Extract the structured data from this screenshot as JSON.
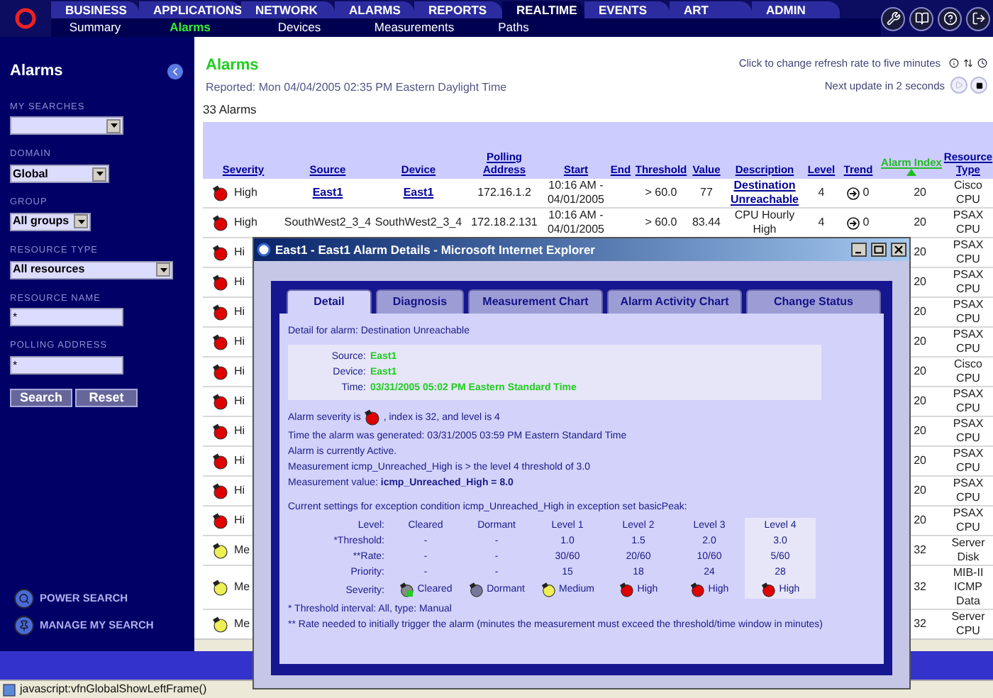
{
  "nav": {
    "tabs": [
      {
        "label": "BUSINESS",
        "selected": false
      },
      {
        "label": "APPLICATIONS",
        "selected": false
      },
      {
        "label": "NETWORK",
        "selected": false
      },
      {
        "label": "ALARMS",
        "selected": false
      },
      {
        "label": "REPORTS",
        "selected": false
      },
      {
        "label": "REALTIME",
        "selected": true
      },
      {
        "label": "EVENTS",
        "selected": false
      },
      {
        "label": "ART",
        "selected": false
      },
      {
        "label": "ADMIN",
        "selected": false
      }
    ],
    "subtabs": [
      {
        "label": "Summary",
        "selected": false
      },
      {
        "label": "Alarms",
        "selected": true
      },
      {
        "label": "Devices",
        "selected": false
      },
      {
        "label": "Measurements",
        "selected": false
      },
      {
        "label": "Paths",
        "selected": false
      }
    ]
  },
  "sidebar": {
    "title": "Alarms",
    "fields": [
      {
        "label": "MY SEARCHES",
        "kind": "select"
      },
      {
        "label": "DOMAIN",
        "kind": "select",
        "value": "Global"
      },
      {
        "label": "GROUP",
        "kind": "select",
        "value": "All groups"
      },
      {
        "label": "RESOURCE TYPE",
        "kind": "select",
        "value": "All resources"
      },
      {
        "label": "RESOURCE NAME",
        "kind": "input",
        "value": "*"
      },
      {
        "label": "POLLING ADDRESS",
        "kind": "input",
        "value": "*"
      }
    ],
    "buttons": [
      "Search",
      "Reset"
    ],
    "links": [
      "POWER SEARCH",
      "MANAGE MY SEARCH"
    ]
  },
  "main": {
    "title": "Alarms",
    "reported": "Reported: Mon 04/04/2005 02:35 PM Eastern Daylight Time",
    "refresh_link": "Click to change refresh rate to five minutes",
    "next_update": "Next update in 2 seconds",
    "count": "33 Alarms"
  },
  "table": {
    "columns": [
      {
        "label": "Severity",
        "sorted": false
      },
      {
        "label": "Source",
        "sorted": false
      },
      {
        "label": "Device",
        "sorted": false
      },
      {
        "label": "Polling Address",
        "sorted": false
      },
      {
        "label": "Start",
        "sorted": false
      },
      {
        "label": "End",
        "sorted": false
      },
      {
        "label": "Threshold",
        "sorted": false
      },
      {
        "label": "Value",
        "sorted": false
      },
      {
        "label": "Description",
        "sorted": false
      },
      {
        "label": "Level",
        "sorted": false
      },
      {
        "label": "Trend",
        "sorted": false
      },
      {
        "label": "Alarm Index",
        "sorted": true
      },
      {
        "label": "Resource Type",
        "sorted": false
      }
    ],
    "rows": [
      {
        "kind": "high",
        "linked": true,
        "severity_label": "High",
        "source": "East1",
        "device": "East1",
        "polling_address": "172.16.1.2",
        "start": "10:16 AM - 04/01/2005",
        "threshold": "> 60.0",
        "value": "77",
        "description": "Destination Unreachable",
        "level": "4",
        "trend": "0",
        "alarm_index": "20",
        "resource_type": "Cisco CPU"
      },
      {
        "kind": "high",
        "linked": false,
        "severity_label": "High",
        "source": "SouthWest2_3_4",
        "device": "SouthWest2_3_4",
        "polling_address": "172.18.2.131",
        "start": "10:16 AM - 04/01/2005",
        "threshold": "> 60.0",
        "value": "83.44",
        "description": "CPU Hourly High",
        "level": "4",
        "trend": "0",
        "alarm_index": "20",
        "resource_type": "PSAX CPU"
      },
      {
        "kind": "high",
        "severity_label": "Hi",
        "alarm_index": "20",
        "resource_type": "PSAX CPU"
      },
      {
        "kind": "high",
        "severity_label": "Hi",
        "alarm_index": "20",
        "resource_type": "PSAX CPU"
      },
      {
        "kind": "high",
        "severity_label": "Hi",
        "alarm_index": "20",
        "resource_type": "PSAX CPU"
      },
      {
        "kind": "high",
        "severity_label": "Hi",
        "alarm_index": "20",
        "resource_type": "PSAX CPU"
      },
      {
        "kind": "high",
        "severity_label": "Hi",
        "alarm_index": "20",
        "resource_type": "Cisco CPU"
      },
      {
        "kind": "high",
        "severity_label": "Hi",
        "alarm_index": "20",
        "resource_type": "PSAX CPU"
      },
      {
        "kind": "high",
        "severity_label": "Hi",
        "alarm_index": "20",
        "resource_type": "PSAX CPU"
      },
      {
        "kind": "high",
        "severity_label": "Hi",
        "alarm_index": "20",
        "resource_type": "PSAX CPU"
      },
      {
        "kind": "high",
        "severity_label": "Hi",
        "alarm_index": "20",
        "resource_type": "PSAX CPU"
      },
      {
        "kind": "high",
        "severity_label": "Hi",
        "alarm_index": "20",
        "resource_type": "PSAX CPU"
      },
      {
        "kind": "medium",
        "severity_label": "Me",
        "alarm_index": "32",
        "resource_type": "Server Disk"
      },
      {
        "kind": "medium",
        "severity_label": "Me",
        "alarm_index": "32",
        "resource_type": "MIB-II ICMP Data"
      },
      {
        "kind": "medium",
        "severity_label": "Me",
        "alarm_index": "32",
        "resource_type": "Server CPU"
      }
    ]
  },
  "dialog": {
    "title": "East1 - East1 Alarm Details - Microsoft Internet Explorer",
    "tabs": [
      {
        "label": "Detail",
        "selected": true
      },
      {
        "label": "Diagnosis",
        "selected": false
      },
      {
        "label": "Measurement Chart",
        "selected": false
      },
      {
        "label": "Alarm Activity Chart",
        "selected": false
      },
      {
        "label": "Change Status",
        "selected": false
      }
    ],
    "detail_for": "Detail for alarm: Destination Unreachable",
    "info": [
      {
        "label": "Source:",
        "value": "East1"
      },
      {
        "label": "Device:",
        "value": "East1"
      },
      {
        "label": "Time:",
        "value": "03/31/2005 05:02 PM Eastern Standard Time"
      }
    ],
    "severity_prefix": "Alarm severity is",
    "severity": {
      "kind": "high"
    },
    "severity_suffix": ", index is 32, and level is 4",
    "lines": [
      "Time the alarm was generated: 03/31/2005 03:59 PM Eastern Standard Time",
      "Alarm is currently Active.",
      "Measurement icmp_Unreached_High is > the level 4 threshold of 3.0",
      "Measurement value: **icmp_Unreached_High = 8.0**"
    ],
    "settings_intro": "Current settings for exception condition icmp_Unreached_High in exception set basicPeak:",
    "settings": {
      "level_label": "Level:",
      "levels": [
        {
          "label": "Cleared",
          "selected": false
        },
        {
          "label": "Dormant",
          "selected": false
        },
        {
          "label": "Level 1",
          "selected": false
        },
        {
          "label": "Level 2",
          "selected": false
        },
        {
          "label": "Level 3",
          "selected": false
        },
        {
          "label": "Level 4",
          "selected": true
        }
      ],
      "rows": [
        {
          "label": "*Threshold:",
          "values": [
            "-",
            "-",
            "1.0",
            "1.5",
            "2.0",
            "3.0"
          ]
        },
        {
          "label": "**Rate:",
          "values": [
            "-",
            "-",
            "30/60",
            "20/60",
            "10/60",
            "5/60"
          ]
        },
        {
          "label": "Priority:",
          "values": [
            "-",
            "-",
            "15",
            "18",
            "24",
            "28"
          ]
        }
      ],
      "severity_label": "Severity:",
      "severities": [
        {
          "kind": "cleared",
          "label": "Cleared"
        },
        {
          "kind": "dormant",
          "label": "Dormant"
        },
        {
          "kind": "medium",
          "label": "Medium"
        },
        {
          "kind": "high",
          "label": "High"
        },
        {
          "kind": "high",
          "label": "High"
        },
        {
          "kind": "high",
          "label": "High"
        }
      ]
    },
    "footnotes": [
      "* Threshold interval: All, type: Manual",
      "** Rate needed to initially trigger the alarm (minutes the measurement must exceed the threshold/time window in minutes)"
    ]
  },
  "status_bar": "javascript:vfnGlobalShowLeftFrame()"
}
